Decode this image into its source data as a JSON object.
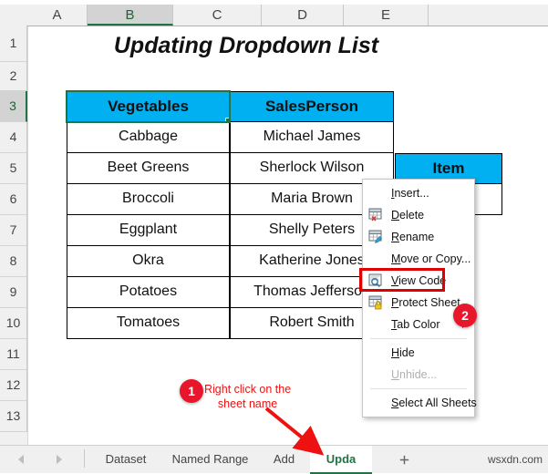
{
  "grid": {
    "columns": [
      {
        "label": "A",
        "selected": false
      },
      {
        "label": "B",
        "selected": true
      },
      {
        "label": "C",
        "selected": false
      },
      {
        "label": "D",
        "selected": false
      },
      {
        "label": "E",
        "selected": false
      }
    ],
    "rows": [
      {
        "label": "1",
        "selected": false
      },
      {
        "label": "2",
        "selected": false
      },
      {
        "label": "3",
        "selected": true
      },
      {
        "label": "4",
        "selected": false
      },
      {
        "label": "5",
        "selected": false
      },
      {
        "label": "6",
        "selected": false
      },
      {
        "label": "7",
        "selected": false
      },
      {
        "label": "8",
        "selected": false
      },
      {
        "label": "9",
        "selected": false
      },
      {
        "label": "10",
        "selected": false
      },
      {
        "label": "11",
        "selected": false
      },
      {
        "label": "12",
        "selected": false
      },
      {
        "label": "13",
        "selected": false
      }
    ],
    "select_all_icon": "select-all-triangle-icon"
  },
  "title": "Updating Dropdown List",
  "table": {
    "headers": [
      "Vegetables",
      "SalesPerson"
    ],
    "rows": [
      [
        "Cabbage",
        "Michael James"
      ],
      [
        "Beet Greens",
        "Sherlock Wilson"
      ],
      [
        "Broccoli",
        "Maria Brown"
      ],
      [
        "Eggplant",
        "Shelly Peters"
      ],
      [
        "Okra",
        "Katherine Jones"
      ],
      [
        "Potatoes",
        "Thomas Jefferson"
      ],
      [
        "Tomatoes",
        "Robert Smith"
      ]
    ],
    "header_fill": "#00b0f0",
    "selection_color": "#217346"
  },
  "item_cell": {
    "label": "Item",
    "fill": "#00b0f0"
  },
  "context_menu": {
    "items": [
      {
        "label": "Insert...",
        "accel": "I",
        "icon": null,
        "disabled": false,
        "submenu": false,
        "separator_after": false
      },
      {
        "label": "Delete",
        "accel": "D",
        "icon": "delete-sheet-icon",
        "disabled": false,
        "submenu": false,
        "separator_after": false
      },
      {
        "label": "Rename",
        "accel": "R",
        "icon": "rename-sheet-icon",
        "disabled": false,
        "submenu": false,
        "separator_after": false
      },
      {
        "label": "Move or Copy...",
        "accel": "M",
        "icon": null,
        "disabled": false,
        "submenu": false,
        "separator_after": false
      },
      {
        "label": "View Code",
        "accel": "V",
        "icon": "view-code-icon",
        "disabled": false,
        "submenu": false,
        "separator_after": false,
        "highlighted": true
      },
      {
        "label": "Protect Sheet...",
        "accel": "P",
        "icon": "protect-sheet-icon",
        "disabled": false,
        "submenu": false,
        "separator_after": false
      },
      {
        "label": "Tab Color",
        "accel": "T",
        "icon": null,
        "disabled": false,
        "submenu": true,
        "separator_after": true
      },
      {
        "label": "Hide",
        "accel": "H",
        "icon": null,
        "disabled": false,
        "submenu": false,
        "separator_after": false
      },
      {
        "label": "Unhide...",
        "accel": "U",
        "icon": null,
        "disabled": true,
        "submenu": false,
        "separator_after": true
      },
      {
        "label": "Select All Sheets",
        "accel": "S",
        "icon": null,
        "disabled": false,
        "submenu": false,
        "separator_after": false
      }
    ],
    "highlight_color": "#e00000"
  },
  "callouts": [
    {
      "number": "1",
      "text_line1": "Right click on the",
      "text_line2": "sheet name"
    },
    {
      "number": "2",
      "text_line1": "",
      "text_line2": ""
    }
  ],
  "tabbar": {
    "nav_prev_icon": "nav-prev-icon",
    "nav_next_icon": "nav-next-icon",
    "tabs": [
      {
        "label": "Dataset",
        "active": false
      },
      {
        "label": "Named Range",
        "active": false
      },
      {
        "label": "Add",
        "active": false
      },
      {
        "label": "Upda",
        "active": true
      }
    ],
    "add_sheet_icon": "add-sheet-icon"
  },
  "watermark": "wsxdn.com"
}
